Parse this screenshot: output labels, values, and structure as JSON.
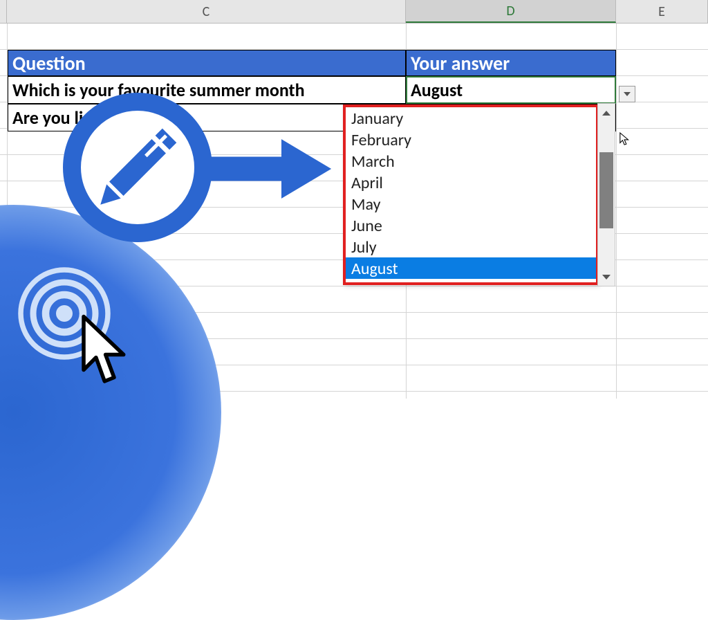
{
  "columns": {
    "c": "C",
    "d": "D",
    "e": "E"
  },
  "headers": {
    "question": "Question",
    "answer": "Your answer"
  },
  "rows": [
    {
      "question": "Which is your favourite summer month",
      "answer": "August"
    },
    {
      "question": "Are you                    liday this year",
      "answer": ""
    }
  ],
  "dropdown": {
    "items": [
      "January",
      "February",
      "March",
      "April",
      "May",
      "June",
      "July",
      "August"
    ],
    "selected": "August"
  },
  "colors": {
    "accent": "#2b66d0",
    "header_bg": "#3a6ccf",
    "highlight_border": "#e02020"
  }
}
